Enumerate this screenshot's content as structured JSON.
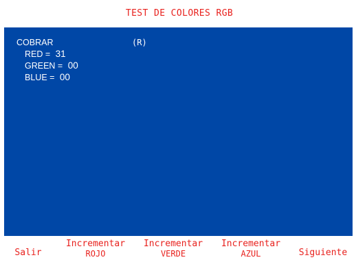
{
  "header": {
    "title": "TEST DE COLORES RGB"
  },
  "panel": {
    "mode_label": "COBRAR",
    "key_hint": "(R)",
    "red": {
      "label": "RED =",
      "value": "31"
    },
    "green": {
      "label": "GREEN =",
      "value": "00"
    },
    "blue": {
      "label": "BLUE =",
      "value": "00"
    }
  },
  "softkeys": {
    "exit": "Salir",
    "inc_red_1": "Incrementar",
    "inc_red_2": "ROJO",
    "inc_green_1": "Incrementar",
    "inc_green_2": "VERDE",
    "inc_blue_1": "Incrementar",
    "inc_blue_2": "AZUL",
    "next": "Siguiente"
  },
  "colors": {
    "panel_bg": "#0047a6",
    "text_red": "#e8211d",
    "text_white": "#ffffff",
    "background": "#ffffff"
  }
}
